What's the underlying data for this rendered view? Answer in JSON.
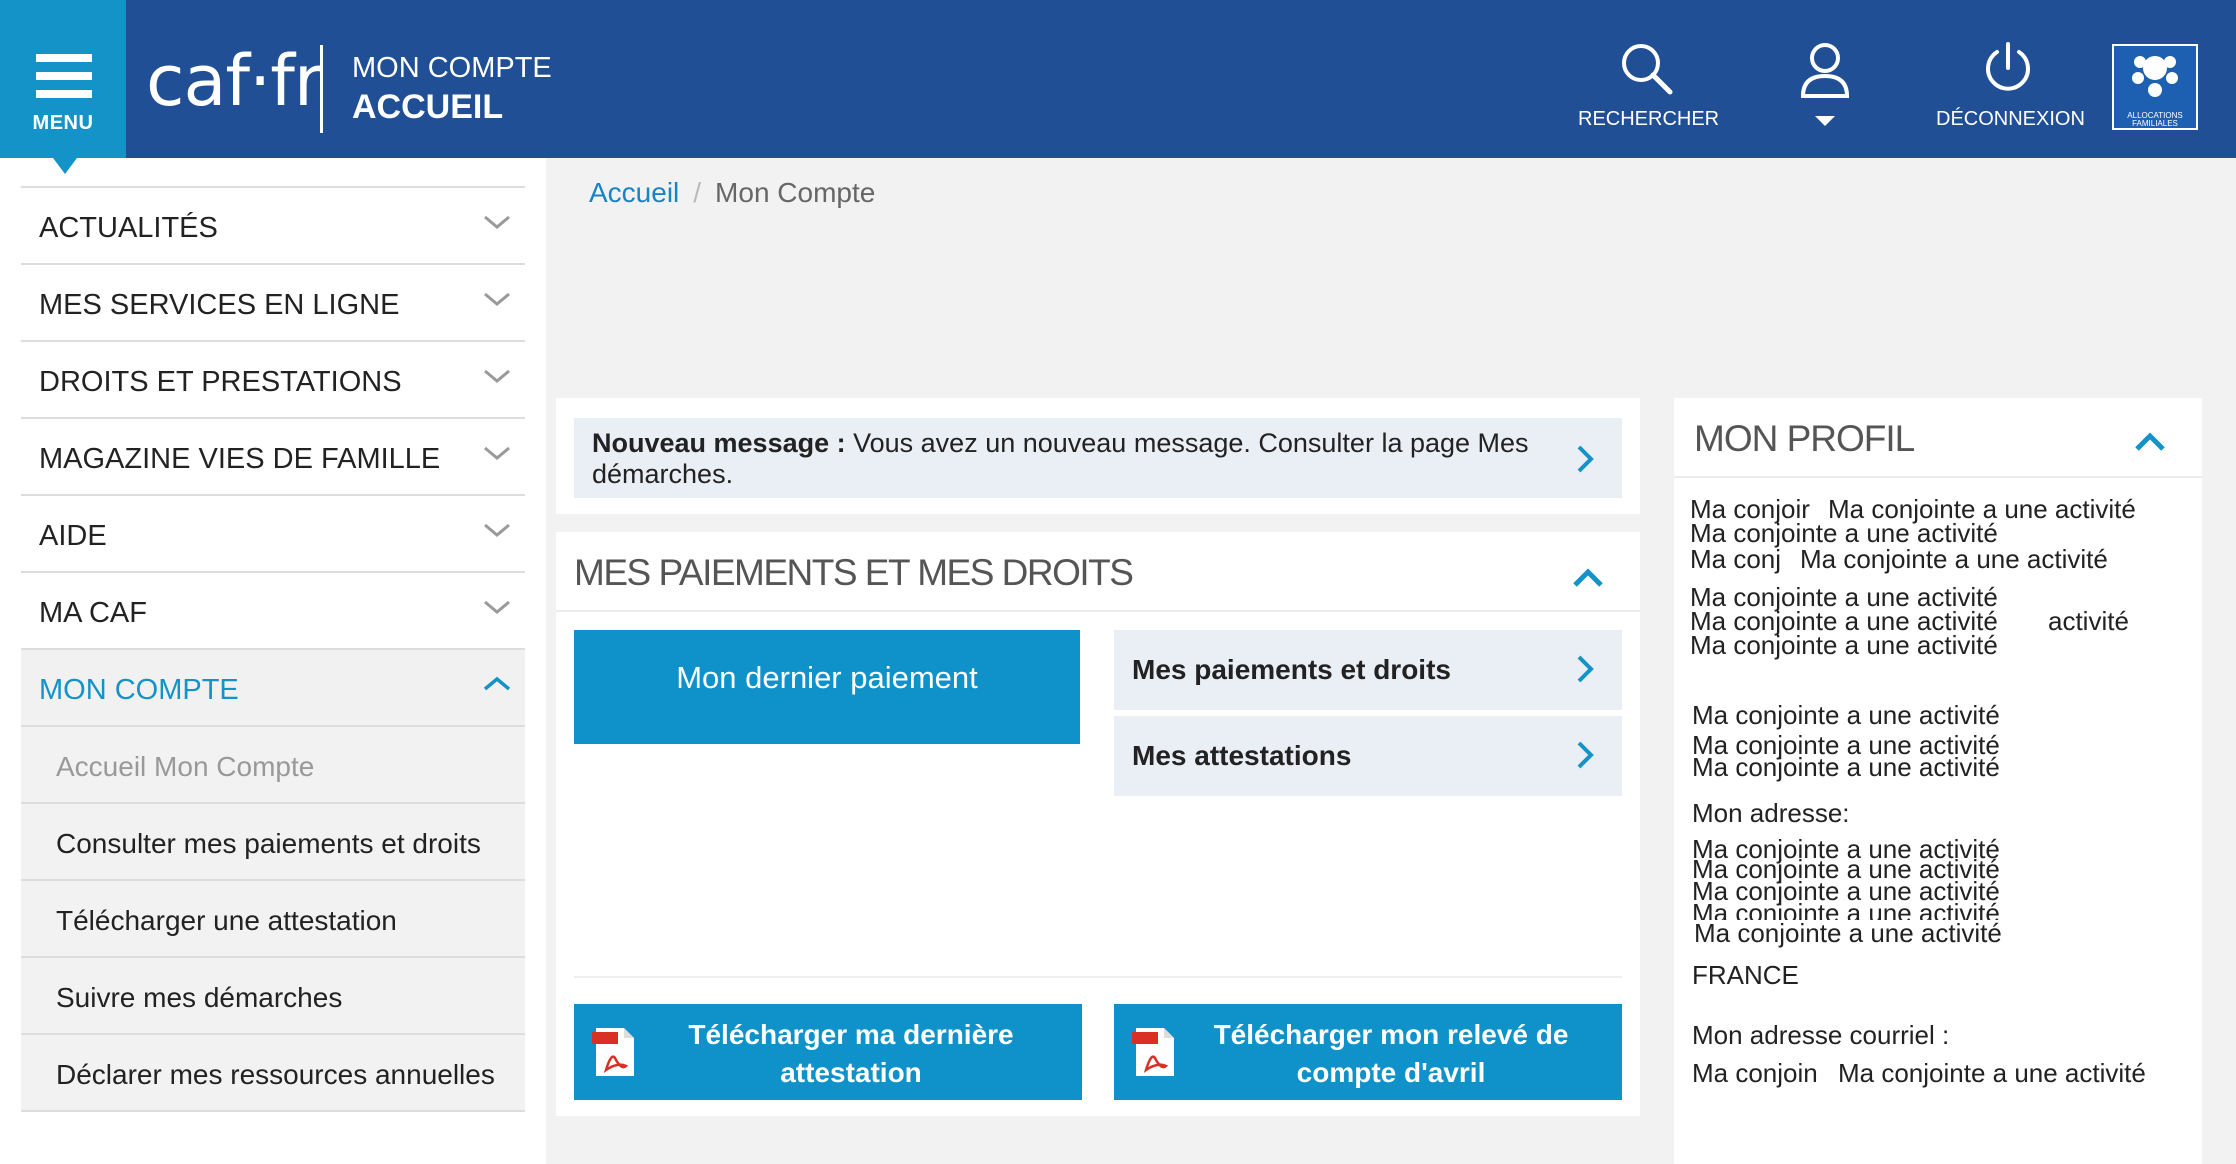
{
  "header": {
    "menu_label": "MENU",
    "logo_text": "caf·fr",
    "title_top": "MON COMPTE",
    "title_main": "ACCUEIL",
    "search_label": "RECHERCHER",
    "logout_label": "DÉCONNEXION",
    "badge_text": "ALLOCATIONS FAMILIALES",
    "icons": {
      "menu": "hamburger-icon",
      "search": "magnifier-icon",
      "user": "user-icon",
      "logout": "power-icon"
    },
    "colors": {
      "bar": "#214f96",
      "accent": "#1393c7"
    }
  },
  "sidebar": {
    "items": [
      {
        "label": "ACTUALITÉS"
      },
      {
        "label": "MES SERVICES EN LIGNE"
      },
      {
        "label": "DROITS ET PRESTATIONS"
      },
      {
        "label": "MAGAZINE VIES DE FAMILLE"
      },
      {
        "label": "AIDE"
      },
      {
        "label": "MA CAF"
      },
      {
        "label": "MON COMPTE",
        "expanded": true
      }
    ],
    "subitems": [
      {
        "label": "Accueil Mon Compte",
        "current": true
      },
      {
        "label": "Consulter mes paiements et droits"
      },
      {
        "label": "Télécharger une attestation"
      },
      {
        "label": "Suivre mes démarches"
      },
      {
        "label": "Déclarer mes ressources annuelles"
      }
    ]
  },
  "breadcrumb": {
    "home": "Accueil",
    "separator": "/",
    "current": "Mon Compte"
  },
  "message": {
    "bold": "Nouveau message :",
    "text": " Vous avez un nouveau message. Consulter la page Mes démarches."
  },
  "payments": {
    "title": "MES PAIEMENTS ET MES DROITS",
    "last_payment_label": "Mon dernier paiement",
    "links": [
      "Mes paiements et droits",
      "Mes attestations"
    ],
    "downloads": [
      "Télécharger ma dernière attestation",
      "Télécharger mon relevé de compte d'avril"
    ]
  },
  "profile": {
    "title": "MON PROFIL",
    "lines": [
      "Ma conjoir",
      "Ma conjointe a une activité",
      "Ma conjointe a une activité",
      "Ma conj",
      "Ma conjointe a une activité",
      "Ma conjointe a une activité",
      "Ma conjointe a une activité",
      "activité",
      "Ma conjointe a une activité",
      "Ma conjointe a une activité",
      "Ma conjointe a une activité",
      "Ma conjointe a une activité",
      "Mon adresse:",
      "Ma conjointe a une activité",
      "Ma conjointe a une activité",
      "Ma conjointe a une activité",
      "Ma conjointe a une activité",
      "Ma conjointe a une activité",
      "FRANCE",
      "Mon adresse courriel :",
      "Ma conjoin",
      "Ma conjointe a une activité"
    ]
  }
}
